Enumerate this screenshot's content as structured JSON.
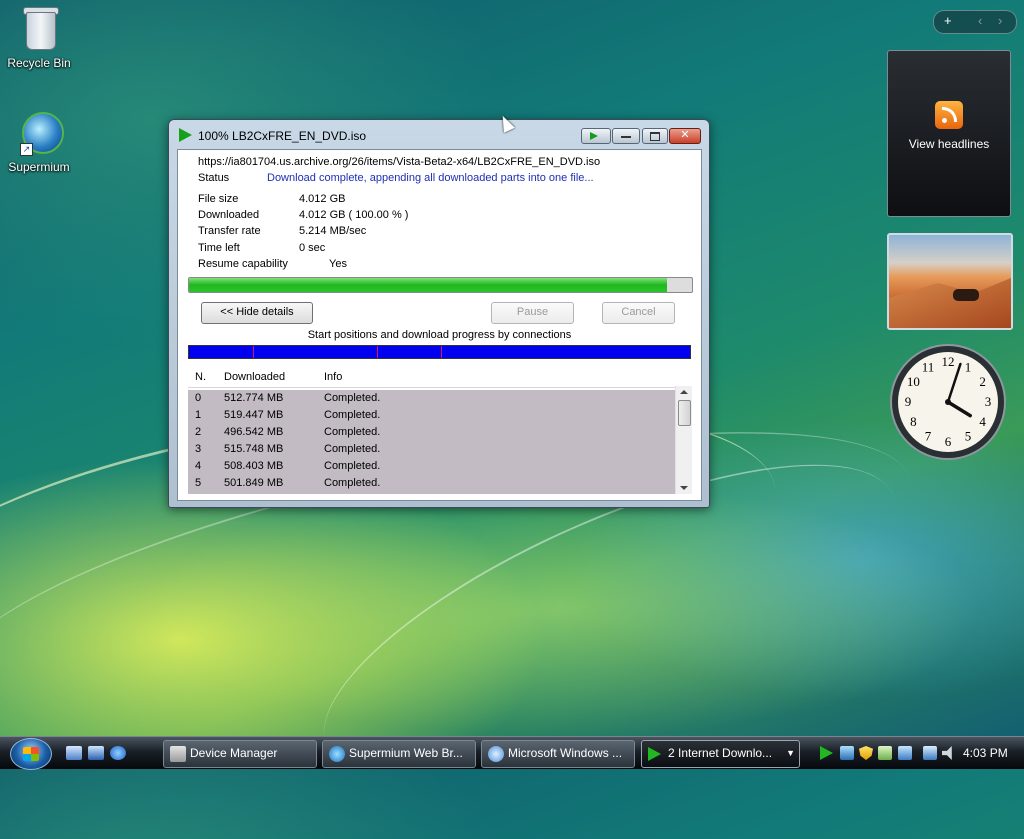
{
  "desktop": {
    "icons": [
      {
        "label": "Recycle Bin",
        "icon": "recycle-bin-icon"
      },
      {
        "label": "Supermium",
        "icon": "supermium-browser-icon"
      }
    ]
  },
  "sidebar": {
    "controls": [
      "+",
      "‹",
      "›"
    ],
    "feed_gadget": {
      "label": "View headlines",
      "icon": "rss-feed-icon"
    },
    "slideshow_gadget": {
      "icon": "desert-oryx-photo"
    },
    "clock_gadget": {
      "hour": 4,
      "minute": 3,
      "numbers": [
        "12",
        "1",
        "2",
        "3",
        "4",
        "5",
        "6",
        "7",
        "8",
        "9",
        "10",
        "11"
      ]
    }
  },
  "download_window": {
    "title": "100% LB2CxFRE_EN_DVD.iso",
    "url": "https://ia801704.us.archive.org/26/items/Vista-Beta2-x64/LB2CxFRE_EN_DVD.iso",
    "status_label": "Status",
    "status_text": "Download complete, appending all downloaded parts into one file...",
    "fields": [
      {
        "label": "File size",
        "value": "4.012  GB"
      },
      {
        "label": "Downloaded",
        "value": "4.012  GB  ( 100.00 % )"
      },
      {
        "label": "Transfer rate",
        "value": "5.214  MB/sec"
      },
      {
        "label": "Time left",
        "value": "0 sec"
      },
      {
        "label": "Resume capability",
        "value": "Yes"
      }
    ],
    "progress": 0.95,
    "buttons": {
      "hide_details": "<< Hide details",
      "pause": "Pause",
      "cancel": "Cancel"
    },
    "connections_label": "Start positions and download progress by connections",
    "connection_starts": [
      0,
      0.128,
      0.375,
      0.502
    ],
    "columns": [
      "N.",
      "Downloaded",
      "Info"
    ],
    "rows": [
      {
        "n": "0",
        "downloaded": "512.774  MB",
        "info": "Completed."
      },
      {
        "n": "1",
        "downloaded": "519.447  MB",
        "info": "Completed."
      },
      {
        "n": "2",
        "downloaded": "496.542  MB",
        "info": "Completed."
      },
      {
        "n": "3",
        "downloaded": "515.748  MB",
        "info": "Completed."
      },
      {
        "n": "4",
        "downloaded": "508.403  MB",
        "info": "Completed."
      },
      {
        "n": "5",
        "downloaded": "501.849  MB",
        "info": "Completed."
      }
    ]
  },
  "taskbar": {
    "tasks": [
      {
        "label": "Device Manager",
        "icon": "device-manager-icon"
      },
      {
        "label": "Supermium Web Br...",
        "icon": "supermium-icon"
      },
      {
        "label": "Microsoft Windows ...",
        "icon": "windows-icon"
      },
      {
        "label": "2 Internet Downlo...",
        "icon": "idm-icon"
      }
    ],
    "clock": "4:03 PM"
  },
  "colors": {
    "progress_green": "#1fb61f",
    "connection_blue": "#0000ee",
    "status_blue": "#1d2fb5"
  }
}
